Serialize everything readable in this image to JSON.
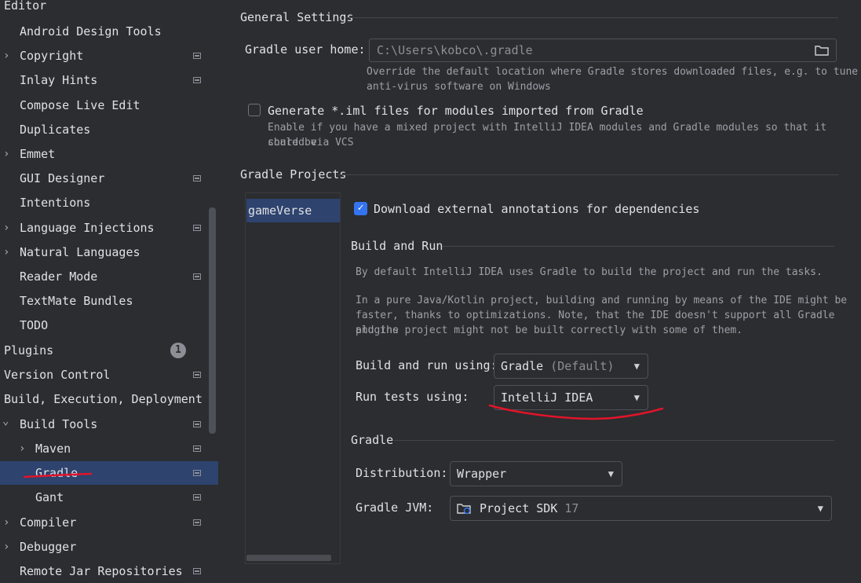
{
  "sidebar": {
    "editor_header": "Editor",
    "items": [
      {
        "label": "Android Design Tools",
        "chevron": false,
        "project_icon": false
      },
      {
        "label": "Copyright",
        "chevron": true,
        "project_icon": true
      },
      {
        "label": "Inlay Hints",
        "chevron": false,
        "project_icon": true
      },
      {
        "label": "Compose Live Edit",
        "chevron": false,
        "project_icon": false
      },
      {
        "label": "Duplicates",
        "chevron": false,
        "project_icon": false
      },
      {
        "label": "Emmet",
        "chevron": true,
        "project_icon": false
      },
      {
        "label": "GUI Designer",
        "chevron": false,
        "project_icon": true
      },
      {
        "label": "Intentions",
        "chevron": false,
        "project_icon": false
      },
      {
        "label": "Language Injections",
        "chevron": true,
        "project_icon": true
      },
      {
        "label": "Natural Languages",
        "chevron": true,
        "project_icon": false
      },
      {
        "label": "Reader Mode",
        "chevron": false,
        "project_icon": true
      },
      {
        "label": "TextMate Bundles",
        "chevron": false,
        "project_icon": false
      },
      {
        "label": "TODO",
        "chevron": false,
        "project_icon": false
      }
    ],
    "plugins_label": "Plugins",
    "plugins_badge": "1",
    "version_control_label": "Version Control",
    "build_header": "Build, Execution, Deployment",
    "build_tools_label": "Build Tools",
    "maven_label": "Maven",
    "gradle_label": "Gradle",
    "gant_label": "Gant",
    "compiler_label": "Compiler",
    "debugger_label": "Debugger",
    "remote_jar_label": "Remote Jar Repositories",
    "chevron_right": "›",
    "chevron_down": "⌄"
  },
  "general": {
    "title": "General Settings",
    "user_home_label": "Gradle user home:",
    "user_home_value": "C:\\Users\\kobco\\.gradle",
    "user_home_hint_1": "Override the default location where Gradle stores downloaded files, e.g. to tune",
    "user_home_hint_2": "anti-virus software on Windows",
    "iml_label": "Generate *.iml files for modules imported from Gradle",
    "iml_checked": false,
    "iml_hint_1": "Enable if you have a mixed project with IntelliJ IDEA modules and Gradle modules so that it could be",
    "iml_hint_2": "shared via VCS"
  },
  "projects": {
    "title": "Gradle Projects",
    "list": [
      "gameVerse"
    ],
    "download_annotations_label": "Download external annotations for dependencies",
    "download_annotations_checked": true,
    "build_run": {
      "title": "Build and Run",
      "desc_1": "By default IntelliJ IDEA uses Gradle to build the project and run the tasks.",
      "desc_2": "In a pure Java/Kotlin project, building and running by means of the IDE might be",
      "desc_3": "faster, thanks to optimizations. Note, that the IDE doesn't support all Gradle plugins",
      "desc_4": "and the project might not be built correctly with some of them.",
      "build_using_label": "Build and run using:",
      "build_using_value": "Gradle",
      "build_using_suffix": "(Default)",
      "tests_using_label": "Run tests using:",
      "tests_using_value": "IntelliJ IDEA"
    },
    "gradle": {
      "title": "Gradle",
      "distribution_label": "Distribution:",
      "distribution_value": "Wrapper",
      "jvm_label": "Gradle JVM:",
      "jvm_value": "Project SDK",
      "jvm_version": "17"
    }
  },
  "colors": {
    "accent": "#3574f0",
    "selection": "#2e436e",
    "annotation": "#e0142a"
  }
}
